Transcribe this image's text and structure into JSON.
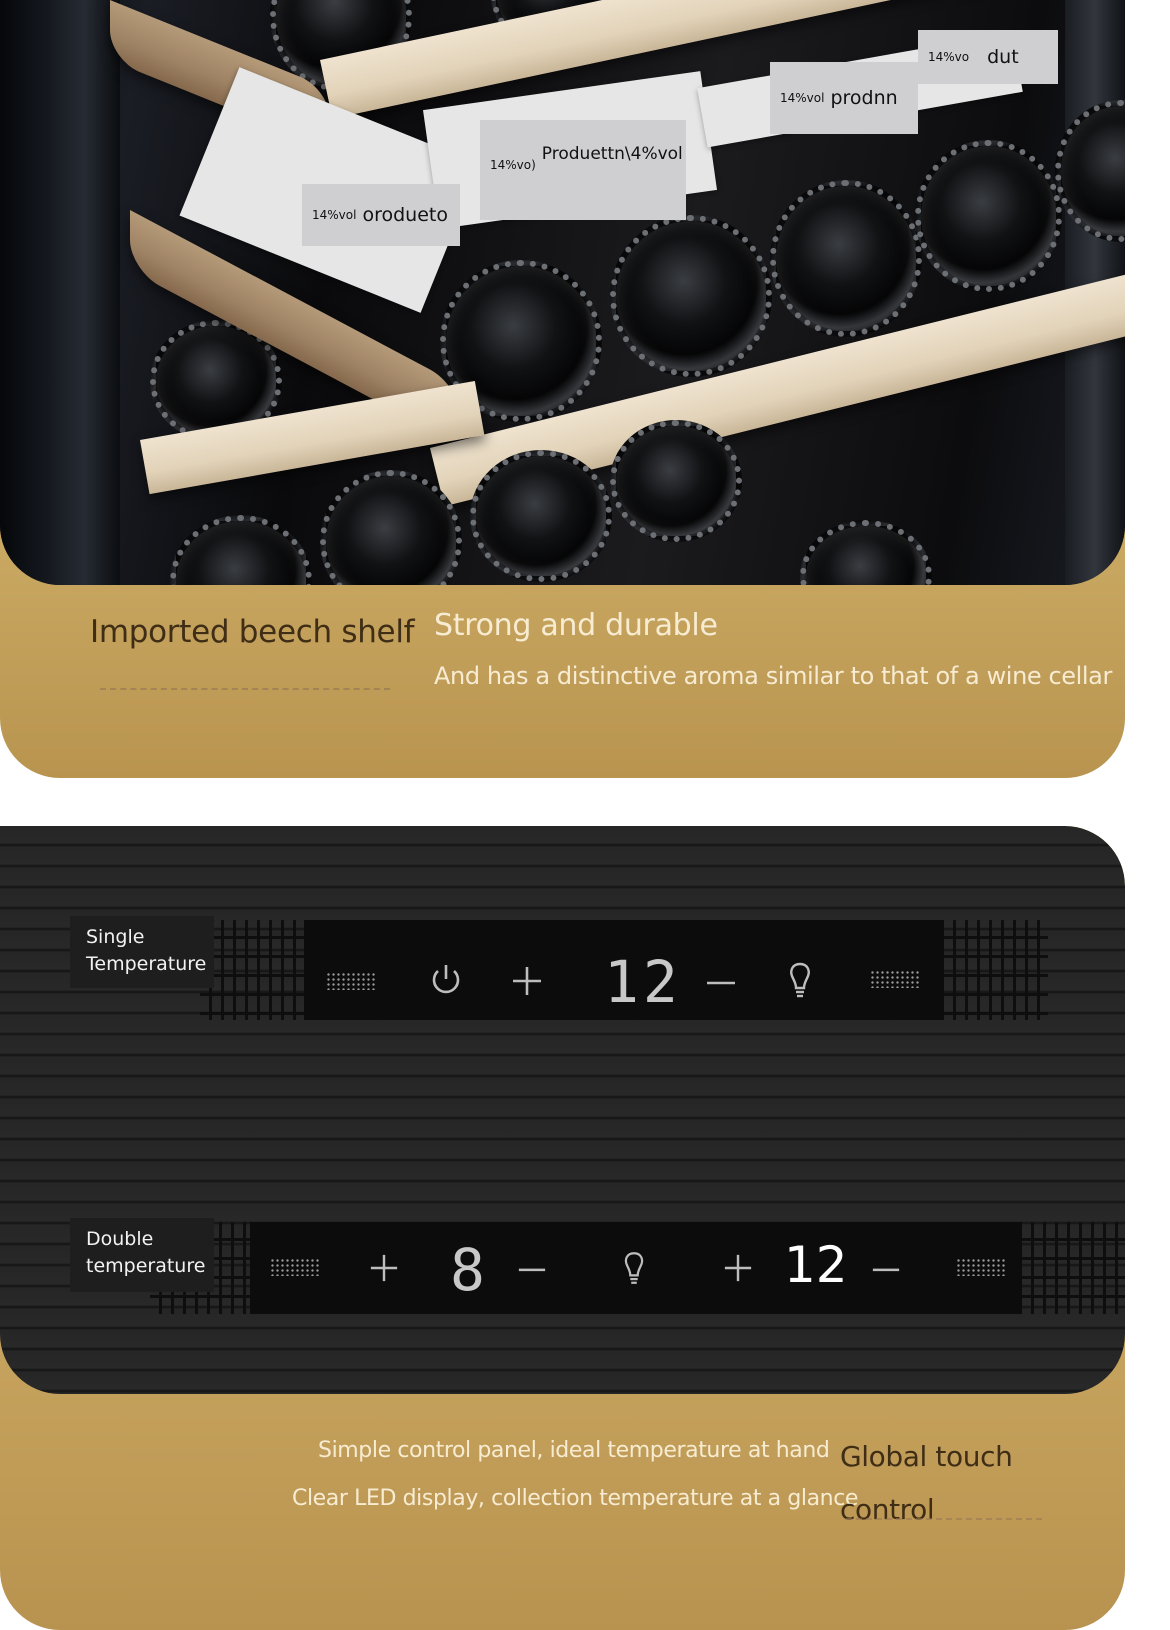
{
  "shelf_section": {
    "product_tags": [
      {
        "small": "14%vo",
        "big": "dut"
      },
      {
        "small": "14%vol",
        "big": "prodnn"
      },
      {
        "small": "14%vo)",
        "big": "Produettn\\4%vol"
      },
      {
        "small": "14%vol",
        "big": "orodueto"
      }
    ],
    "feature_title": "Imported beech shelf",
    "headline": "Strong and durable",
    "subline": "And has a distinctive aroma similar to that of a wine cellar",
    "colors": {
      "gold": "#cba963",
      "dark_text": "#3f2d16",
      "light_text": "#f7ecd2"
    }
  },
  "control_section": {
    "single": {
      "label_line1": "Single",
      "label_line2": "Temperature",
      "icons": [
        "power-icon",
        "plus-icon",
        "minus-icon",
        "light-bulb-icon"
      ],
      "display": "12",
      "plus": "+",
      "minus": "−"
    },
    "double": {
      "label_line1": "Double",
      "label_line2": "temperature",
      "zone1_display": "8",
      "zone2_display": "12",
      "plus": "+",
      "minus": "−"
    },
    "caption_line1": "Simple control panel, ideal temperature at hand",
    "caption_line2": "Clear LED display, collection temperature at a glance",
    "title": "Global touch control",
    "colors": {
      "panel": "#262626",
      "display": "#0c0c0c"
    }
  }
}
